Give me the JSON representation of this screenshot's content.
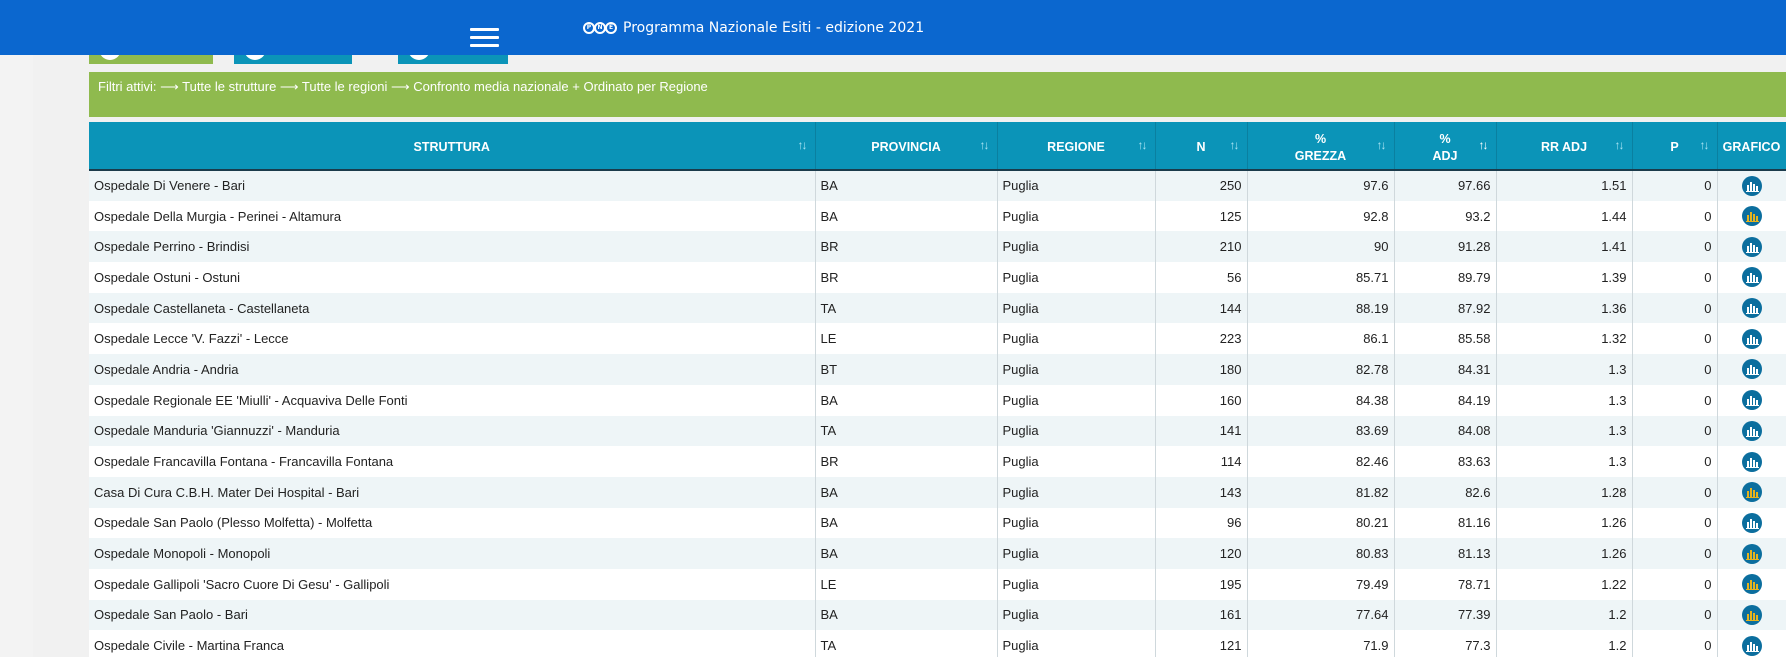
{
  "header": {
    "logo_letters": [
      "P",
      "N",
      "E"
    ],
    "title": "Programma Nazionale Esiti - edizione 2021"
  },
  "filter_bar": {
    "text": "Filtri attivi: ⟶ Tutte le strutture ⟶ Tutte le regioni ⟶ Confronto media nazionale + Ordinato per Regione"
  },
  "table": {
    "columns": [
      {
        "key": "struttura",
        "label": "STRUTTURA",
        "sort": "↑↓"
      },
      {
        "key": "provincia",
        "label": "PROVINCIA",
        "sort": "↑↓"
      },
      {
        "key": "regione",
        "label": "REGIONE",
        "sort": "↑↓"
      },
      {
        "key": "n",
        "label": "N",
        "sort": "↑↓"
      },
      {
        "key": "grezza",
        "label": "%\nGREZZA",
        "sort": "↑↓"
      },
      {
        "key": "adj",
        "label": "%\nADJ",
        "sort": "↑↓"
      },
      {
        "key": "rr_adj",
        "label": "RR ADJ",
        "sort": "↑↓"
      },
      {
        "key": "p",
        "label": "P",
        "sort": "↑↓"
      },
      {
        "key": "grafico",
        "label": "GRAFICO",
        "sort": ""
      }
    ],
    "rows": [
      {
        "struttura": "Ospedale Di Venere - Bari",
        "provincia": "BA",
        "regione": "Puglia",
        "n": "250",
        "grezza": "97.6",
        "adj": "97.66",
        "rr_adj": "1.51",
        "p": "0",
        "icon": "bar-chart-icon"
      },
      {
        "struttura": "Ospedale Della Murgia - Perinei - Altamura",
        "provincia": "BA",
        "regione": "Puglia",
        "n": "125",
        "grezza": "92.8",
        "adj": "93.2",
        "rr_adj": "1.44",
        "p": "0",
        "icon": "bar-chart-gold-icon"
      },
      {
        "struttura": "Ospedale Perrino - Brindisi",
        "provincia": "BR",
        "regione": "Puglia",
        "n": "210",
        "grezza": "90",
        "adj": "91.28",
        "rr_adj": "1.41",
        "p": "0",
        "icon": "bar-chart-icon"
      },
      {
        "struttura": "Ospedale Ostuni - Ostuni",
        "provincia": "BR",
        "regione": "Puglia",
        "n": "56",
        "grezza": "85.71",
        "adj": "89.79",
        "rr_adj": "1.39",
        "p": "0",
        "icon": "bar-chart-icon"
      },
      {
        "struttura": "Ospedale Castellaneta - Castellaneta",
        "provincia": "TA",
        "regione": "Puglia",
        "n": "144",
        "grezza": "88.19",
        "adj": "87.92",
        "rr_adj": "1.36",
        "p": "0",
        "icon": "bar-chart-icon"
      },
      {
        "struttura": "Ospedale Lecce 'V. Fazzi' - Lecce",
        "provincia": "LE",
        "regione": "Puglia",
        "n": "223",
        "grezza": "86.1",
        "adj": "85.58",
        "rr_adj": "1.32",
        "p": "0",
        "icon": "bar-chart-icon"
      },
      {
        "struttura": "Ospedale Andria - Andria",
        "provincia": "BT",
        "regione": "Puglia",
        "n": "180",
        "grezza": "82.78",
        "adj": "84.31",
        "rr_adj": "1.3",
        "p": "0",
        "icon": "bar-chart-icon"
      },
      {
        "struttura": "Ospedale Regionale EE 'Miulli' - Acquaviva Delle Fonti",
        "provincia": "BA",
        "regione": "Puglia",
        "n": "160",
        "grezza": "84.38",
        "adj": "84.19",
        "rr_adj": "1.3",
        "p": "0",
        "icon": "bar-chart-icon"
      },
      {
        "struttura": "Ospedale Manduria 'Giannuzzi' - Manduria",
        "provincia": "TA",
        "regione": "Puglia",
        "n": "141",
        "grezza": "83.69",
        "adj": "84.08",
        "rr_adj": "1.3",
        "p": "0",
        "icon": "bar-chart-icon"
      },
      {
        "struttura": "Ospedale Francavilla Fontana - Francavilla Fontana",
        "provincia": "BR",
        "regione": "Puglia",
        "n": "114",
        "grezza": "82.46",
        "adj": "83.63",
        "rr_adj": "1.3",
        "p": "0",
        "icon": "bar-chart-icon"
      },
      {
        "struttura": "Casa Di Cura C.B.H. Mater Dei Hospital - Bari",
        "provincia": "BA",
        "regione": "Puglia",
        "n": "143",
        "grezza": "81.82",
        "adj": "82.6",
        "rr_adj": "1.28",
        "p": "0",
        "icon": "bar-chart-gold-icon"
      },
      {
        "struttura": "Ospedale San Paolo (Plesso Molfetta) - Molfetta",
        "provincia": "BA",
        "regione": "Puglia",
        "n": "96",
        "grezza": "80.21",
        "adj": "81.16",
        "rr_adj": "1.26",
        "p": "0",
        "icon": "bar-chart-icon"
      },
      {
        "struttura": "Ospedale Monopoli - Monopoli",
        "provincia": "BA",
        "regione": "Puglia",
        "n": "120",
        "grezza": "80.83",
        "adj": "81.13",
        "rr_adj": "1.26",
        "p": "0",
        "icon": "bar-chart-gold-icon"
      },
      {
        "struttura": "Ospedale Gallipoli 'Sacro Cuore Di Gesu' - Gallipoli",
        "provincia": "LE",
        "regione": "Puglia",
        "n": "195",
        "grezza": "79.49",
        "adj": "78.71",
        "rr_adj": "1.22",
        "p": "0",
        "icon": "bar-chart-gold-icon"
      },
      {
        "struttura": "Ospedale San Paolo - Bari",
        "provincia": "BA",
        "regione": "Puglia",
        "n": "161",
        "grezza": "77.64",
        "adj": "77.39",
        "rr_adj": "1.2",
        "p": "0",
        "icon": "bar-chart-gold-icon"
      },
      {
        "struttura": "Ospedale Civile - Martina Franca",
        "provincia": "TA",
        "regione": "Puglia",
        "n": "121",
        "grezza": "71.9",
        "adj": "77.3",
        "rr_adj": "1.2",
        "p": "0",
        "icon": "bar-chart-icon"
      }
    ]
  },
  "colors": {
    "topbar": "#0b67cf",
    "filter_bar": "#8fba4e",
    "table_header": "#0b94b8",
    "icon_blue": "#0b6e9e",
    "icon_gold": "#e6b31d"
  }
}
